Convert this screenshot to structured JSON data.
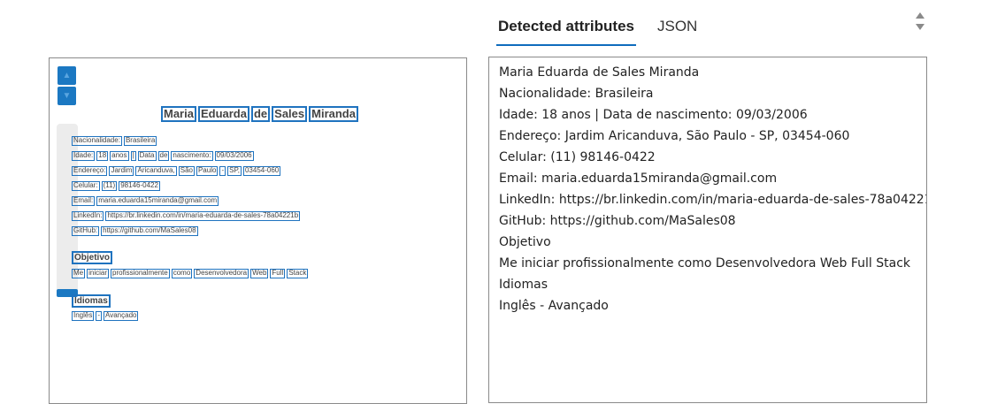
{
  "tabs": [
    {
      "label": "Detected attributes",
      "active": true
    },
    {
      "label": "JSON",
      "active": false
    }
  ],
  "accent_color": "#0f6cbd",
  "box_color": "#1f73bf",
  "preview": {
    "zoom_in_icon": "plus-icon",
    "zoom_out_icon": "minus-icon",
    "rows": [
      {
        "words": [
          "Maria",
          "Eduarda",
          "de",
          "Sales",
          "Miranda"
        ]
      },
      {
        "words": [
          "Nacionalidade:",
          "Brasileira"
        ]
      },
      {
        "words": [
          "Idade:",
          "18",
          "anos",
          "|",
          "Data",
          "de",
          "nascimento:",
          "09/03/2006"
        ]
      },
      {
        "words": [
          "Endereço:",
          "Jardim",
          "Aricanduva,",
          "São",
          "Paulo",
          "-",
          "SP,",
          "03454-060"
        ]
      },
      {
        "words": [
          "Celular:",
          "(11)",
          "98146-0422"
        ]
      },
      {
        "words": [
          "Email:",
          "maria.eduarda15miranda@gmail.com"
        ]
      },
      {
        "words": [
          "LinkedIn:",
          "https://br.linkedin.com/in/maria-eduarda-de-sales-78a04221b"
        ]
      },
      {
        "words": [
          "GitHub:",
          "https://github.com/MaSales08"
        ]
      },
      {
        "words": [
          "Objetivo"
        ]
      },
      {
        "words": [
          "Me",
          "iniciar",
          "profissionalmente",
          "como",
          "Desenvolvedora",
          "Web",
          "Full",
          "Stack"
        ]
      },
      {
        "words": [
          "Idiomas"
        ]
      },
      {
        "words": [
          "Inglês",
          "-",
          "Avançado"
        ]
      }
    ]
  },
  "extracted_lines": [
    "Maria Eduarda de Sales Miranda",
    "Nacionalidade: Brasileira",
    "Idade: 18 anos | Data de nascimento: 09/03/2006",
    "Endereço: Jardim Aricanduva, São Paulo - SP, 03454-060",
    "Celular: (11) 98146-0422",
    "Email: maria.eduarda15miranda@gmail.com",
    "LinkedIn: https://br.linkedin.com/in/maria-eduarda-de-sales-78a04221b",
    "GitHub: https://github.com/MaSales08",
    "Objetivo",
    "Me iniciar profissionalmente como Desenvolvedora Web Full Stack",
    "Idiomas",
    "Inglês - Avançado"
  ]
}
